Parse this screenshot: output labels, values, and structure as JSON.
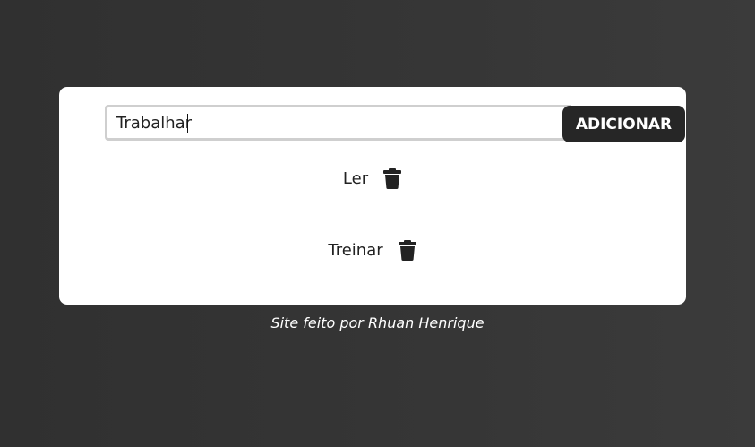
{
  "form": {
    "input_value": "Trabalhar",
    "add_label": "ADICIONAR"
  },
  "tasks": [
    {
      "label": "Ler",
      "delete_icon": "trash-icon"
    },
    {
      "label": "Treinar",
      "delete_icon": "trash-icon"
    }
  ],
  "footer": {
    "credit": "Site feito por Rhuan Henrique"
  },
  "colors": {
    "background": "#333333",
    "card": "#ffffff",
    "button": "#262626",
    "input_border": "#cfcfcf"
  }
}
